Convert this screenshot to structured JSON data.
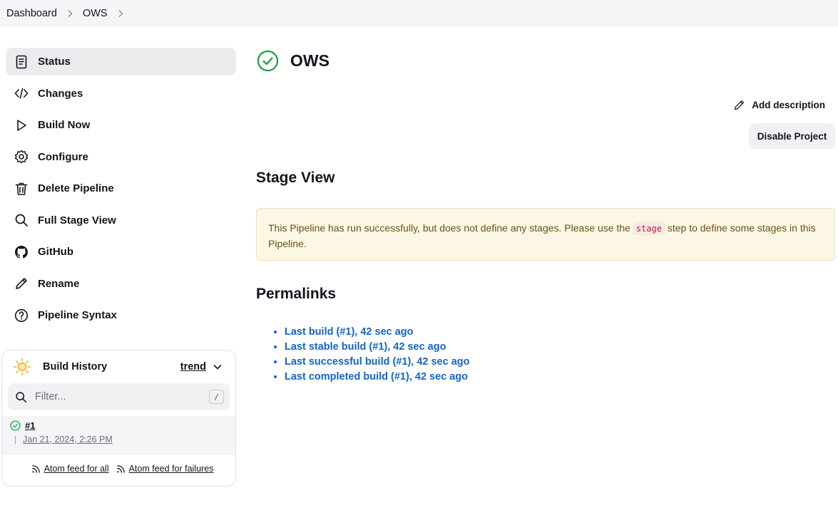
{
  "breadcrumb": {
    "items": [
      "Dashboard",
      "OWS"
    ]
  },
  "sidebar": {
    "items": [
      {
        "label": "Status",
        "icon": "document-icon"
      },
      {
        "label": "Changes",
        "icon": "code-icon"
      },
      {
        "label": "Build Now",
        "icon": "play-icon"
      },
      {
        "label": "Configure",
        "icon": "gear-icon"
      },
      {
        "label": "Delete Pipeline",
        "icon": "trash-icon"
      },
      {
        "label": "Full Stage View",
        "icon": "search-icon"
      },
      {
        "label": "GitHub",
        "icon": "github-icon"
      },
      {
        "label": "Rename",
        "icon": "pencil-icon"
      },
      {
        "label": "Pipeline Syntax",
        "icon": "help-icon"
      }
    ]
  },
  "build_history": {
    "title": "Build History",
    "trend_label": "trend",
    "filter_placeholder": "Filter...",
    "shortcut": "/",
    "builds": [
      {
        "number": "#1",
        "date": "Jan 21, 2024, 2:26 PM",
        "status": "success"
      }
    ],
    "feed_all": "Atom feed for all",
    "feed_failures": "Atom feed for failures"
  },
  "main": {
    "title": "OWS",
    "add_description": "Add description",
    "disable_project": "Disable Project",
    "stage_view_heading": "Stage View",
    "notice": {
      "before": "This Pipeline has run successfully, but does not define any stages. Please use the ",
      "code": "stage",
      "after": " step to define some stages in this Pipeline."
    },
    "permalinks_heading": "Permalinks",
    "permalinks": [
      "Last build (#1), 42 sec ago",
      "Last stable build (#1), 42 sec ago",
      "Last successful build (#1), 42 sec ago",
      "Last completed build (#1), 42 sec ago"
    ]
  },
  "colors": {
    "success": "#1ea446",
    "link": "#1463cf",
    "notice_bg": "#fcf6e4"
  }
}
